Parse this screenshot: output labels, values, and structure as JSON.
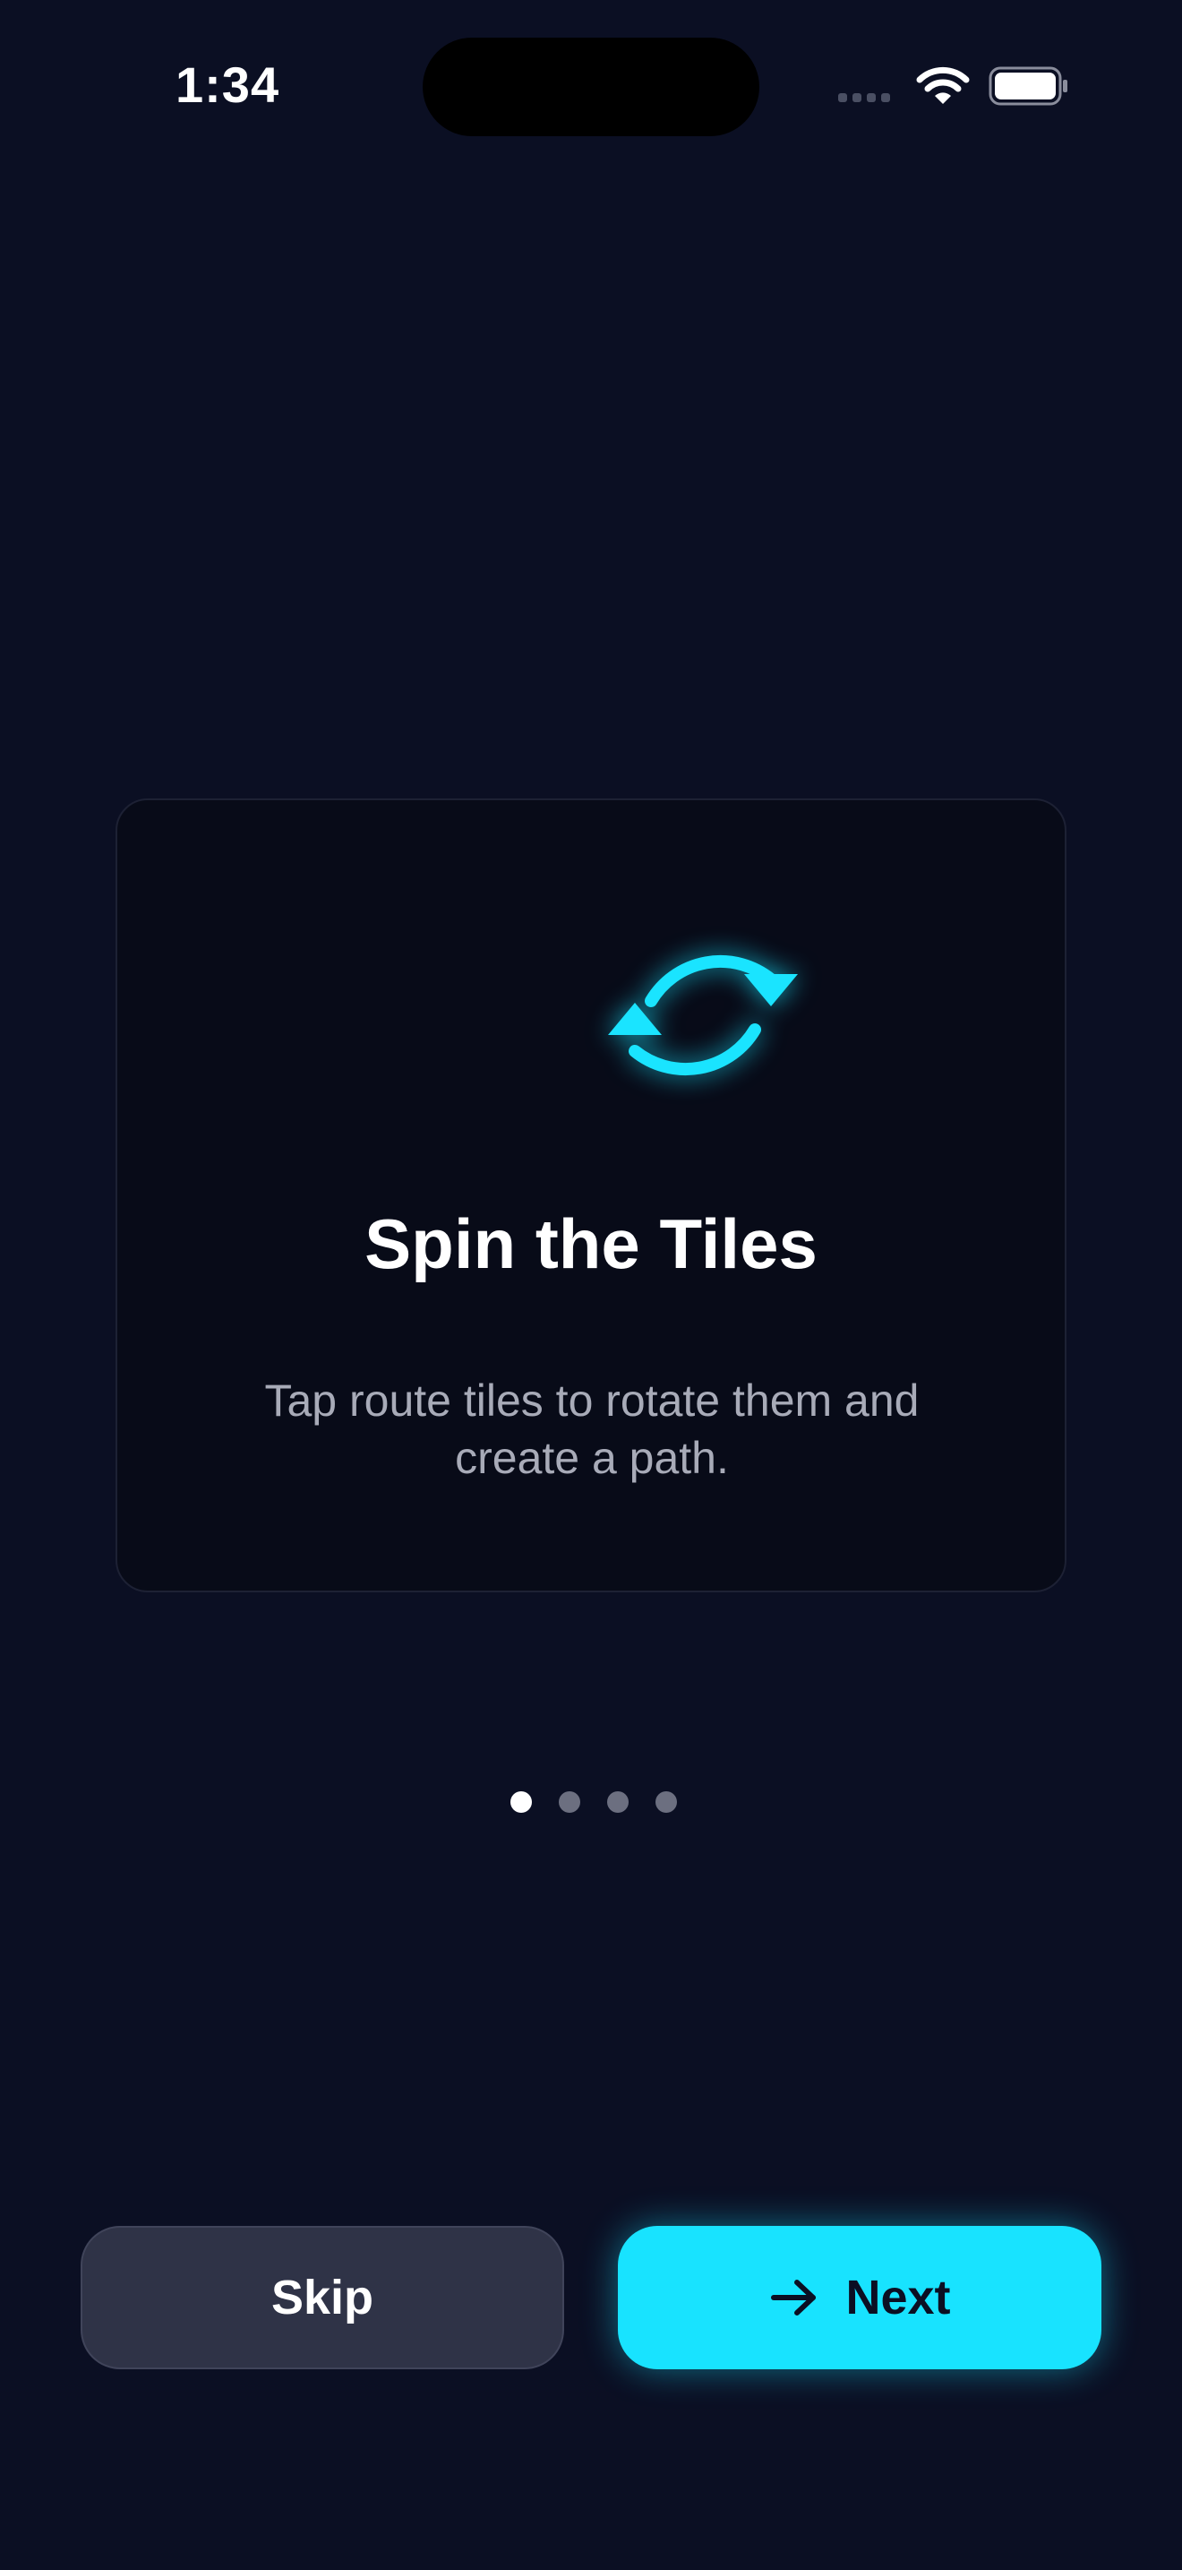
{
  "status_bar": {
    "time": "1:34"
  },
  "card": {
    "icon": "rotate-arrows-icon",
    "title": "Spin the Tiles",
    "description": "Tap route tiles to rotate them and create a path."
  },
  "pagination": {
    "total": 4,
    "current": 1
  },
  "actions": {
    "skip_label": "Skip",
    "next_label": "Next",
    "next_icon": "arrow-right-icon"
  },
  "colors": {
    "background": "#0b0f23",
    "accent": "#18e3ff",
    "card": "#080b18",
    "secondary_button": "#2f3347"
  }
}
